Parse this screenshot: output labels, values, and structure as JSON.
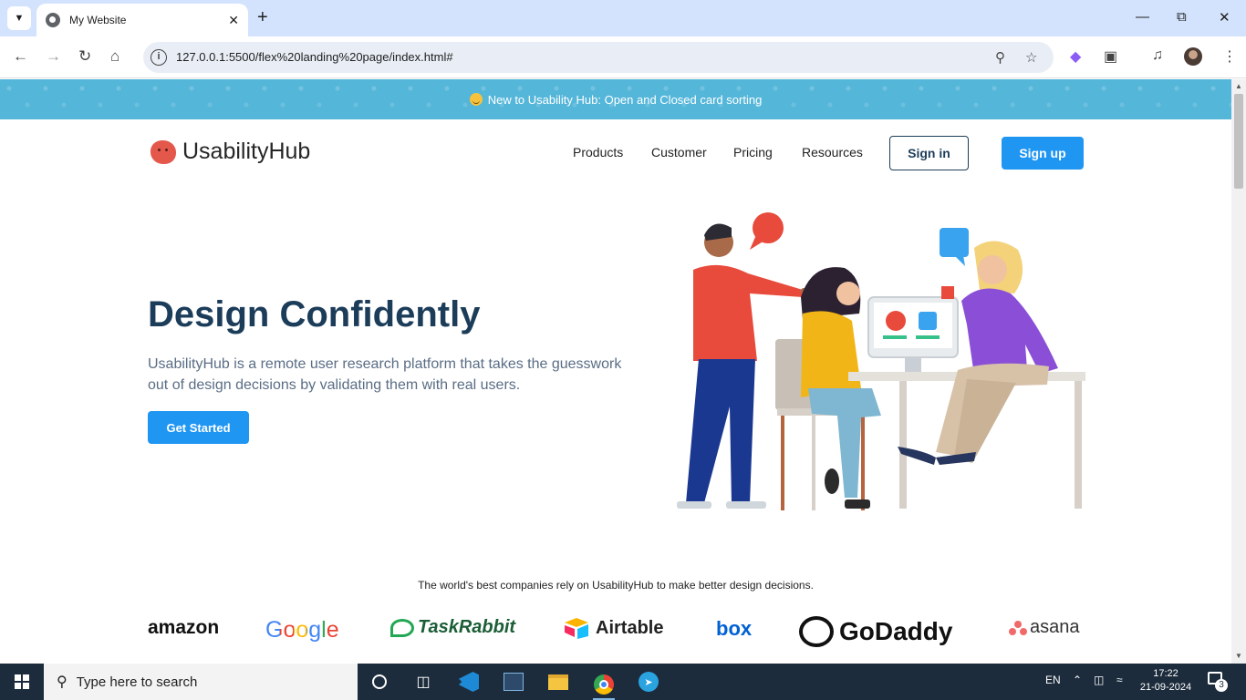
{
  "browser": {
    "tab_title": "My Website",
    "url": "127.0.0.1:5500/flex%20landing%20page/index.html#"
  },
  "banner": {
    "text": "New to Usability Hub: Open and Closed card sorting"
  },
  "header": {
    "logo_text": "UsabilityHub",
    "nav": [
      "Products",
      "Customer",
      "Pricing",
      "Resources"
    ],
    "signin_label": "Sign in",
    "signup_label": "Sign up"
  },
  "hero": {
    "title": "Design Confidently",
    "description": "UsabilityHub is a remote user research platform that takes the guesswork out of design decisions by validating them with real users.",
    "cta_label": "Get Started"
  },
  "trust": {
    "text": "The world's best companies rely on UsabilityHub to make better design decisions.",
    "brands": [
      "amazon",
      "Google",
      "TaskRabbit",
      "Airtable",
      "box",
      "GoDaddy",
      "asana"
    ]
  },
  "taskbar": {
    "search_placeholder": "Type here to search",
    "language": "EN",
    "time": "17:22",
    "date": "21-09-2024",
    "notification_count": "3"
  },
  "colors": {
    "banner_bg": "#54b6d9",
    "primary": "#2096f3",
    "heading": "#1c3d5a",
    "logo_red": "#e4574b"
  }
}
